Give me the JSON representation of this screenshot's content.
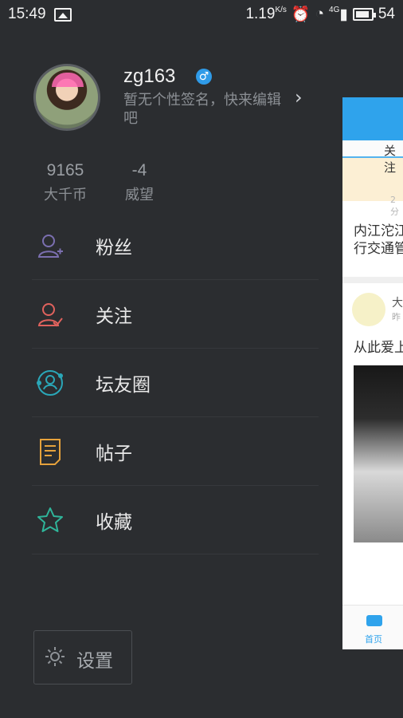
{
  "status_bar": {
    "time": "15:49",
    "net_speed": "1.19",
    "net_unit": "K/s",
    "signal": "4G",
    "battery": "54"
  },
  "profile": {
    "username": "zg163",
    "gender_symbol": "♂",
    "signature": "暂无个性签名，快来编辑吧"
  },
  "stats": [
    {
      "value": "9165",
      "label": "大千币"
    },
    {
      "value": "-4",
      "label": "威望"
    }
  ],
  "menu": {
    "items": [
      {
        "label": "粉丝",
        "icon": "fans-icon",
        "color": "#7b6fb0"
      },
      {
        "label": "关注",
        "icon": "follow-icon",
        "color": "#e0625d"
      },
      {
        "label": "坛友圈",
        "icon": "circle-icon",
        "color": "#2aa7b8"
      },
      {
        "label": "帖子",
        "icon": "post-icon",
        "color": "#e6a23c"
      },
      {
        "label": "收藏",
        "icon": "star-icon",
        "color": "#2fb59a"
      }
    ]
  },
  "settings": {
    "label": "设置"
  },
  "peek": {
    "tab_label": "关注",
    "age": "2分",
    "news_line1": "内江沱江",
    "news_line2": "行交通管",
    "post_name": "大",
    "post_time": "昨",
    "post_title": "从此爱上",
    "nav_label": "首页"
  },
  "colors": {
    "background": "#2b2d30",
    "accent": "#2fa3ec"
  }
}
